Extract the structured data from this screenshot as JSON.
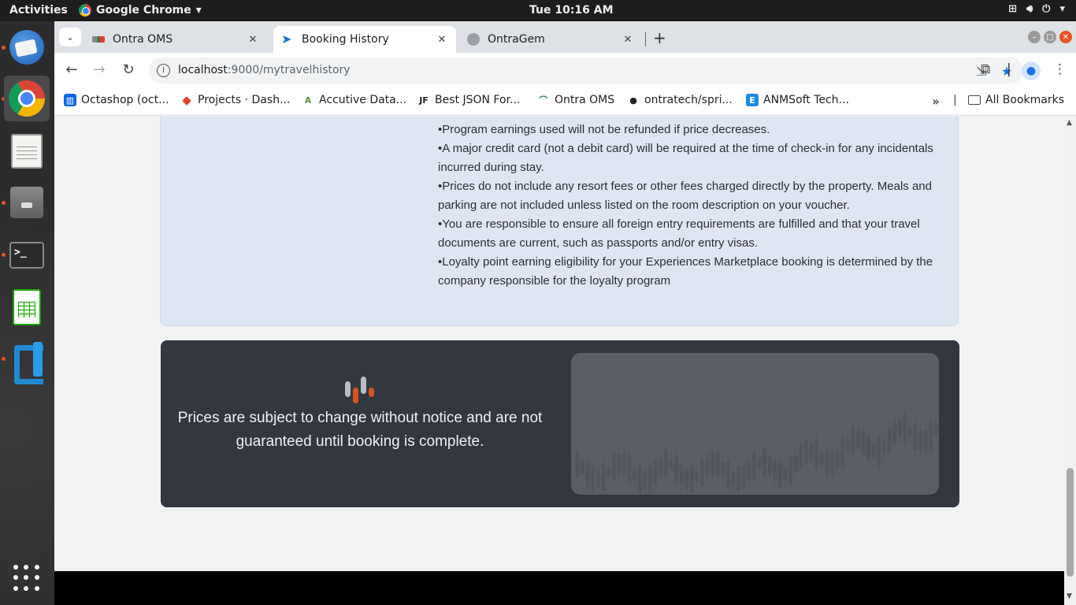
{
  "system_bar": {
    "activities": "Activities",
    "app_name": "Google Chrome",
    "clock": "Tue 10:16 AM"
  },
  "dock": {
    "apps": [
      "thunderbird-icon",
      "chrome-icon",
      "text-editor-icon",
      "files-icon",
      "terminal-icon",
      "spreadsheet-icon",
      "vscode-icon"
    ]
  },
  "tabs": [
    {
      "title": "Ontra OMS",
      "active": false
    },
    {
      "title": "Booking History",
      "active": true
    },
    {
      "title": "OntraGem",
      "active": false
    }
  ],
  "address_bar": {
    "host": "localhost",
    "path": ":9000/mytravelhistory"
  },
  "bookmarks": [
    {
      "label": "Octashop (oct...",
      "color": "#0c66e4"
    },
    {
      "label": "Projects · Dash...",
      "color": "#e24329"
    },
    {
      "label": "Accutive Data...",
      "color": "#5a8f3c"
    },
    {
      "label": "Best JSON For...",
      "color": "#222222"
    },
    {
      "label": "Ontra OMS",
      "color": "#2e7d32"
    },
    {
      "label": "ontratech/spri...",
      "color": "#222222"
    },
    {
      "label": "ANMSoft Tech...",
      "color": "#1e88e5"
    }
  ],
  "bookmarks_overflow": "»",
  "all_bookmarks": "All Bookmarks",
  "policies": [
    "•Program earnings used will not be refunded if price decreases.",
    "•A major credit card (not a debit card) will be required at the time of check-in for any incidentals incurred during stay.",
    "•Prices do not include any resort fees or other fees charged directly by the property.  Meals and parking are not included unless listed on the room description on your voucher.",
    "•You are responsible to ensure all foreign entry requirements are fulfilled and that your travel documents are current, such as passports and/or entry visas.",
    "•Loyalty point earning eligibility for your Experiences Marketplace booking is determined by the company responsible for the loyalty program"
  ],
  "notice": {
    "text": "Prices are subject to change without notice and are not guaranteed until booking is complete."
  },
  "colors": {
    "accent_orange": "#d4541c",
    "notice_bg": "#33373f",
    "policy_bg": "#dfe6f3"
  }
}
